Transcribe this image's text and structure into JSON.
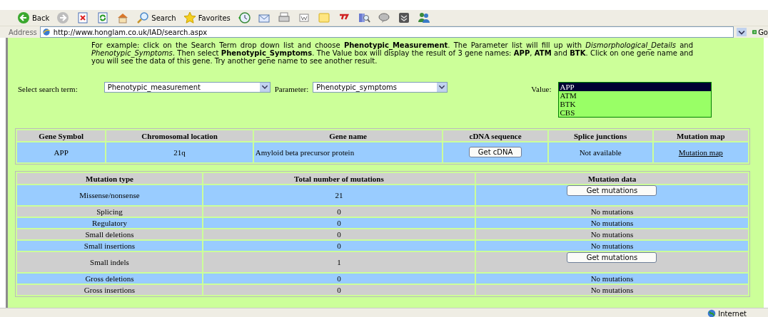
{
  "toolbar": {
    "buttons": [
      {
        "kind": "back",
        "label": "Back"
      },
      {
        "kind": "forward"
      },
      {
        "kind": "stop"
      },
      {
        "kind": "refresh"
      },
      {
        "kind": "home"
      },
      {
        "kind": "search",
        "label": "Search"
      },
      {
        "kind": "favorites",
        "label": "Favorites"
      },
      {
        "kind": "history"
      },
      {
        "kind": "mail"
      },
      {
        "kind": "print"
      },
      {
        "kind": "edit"
      },
      {
        "kind": "note"
      },
      {
        "kind": "yahoo"
      },
      {
        "kind": "research"
      },
      {
        "kind": "messenger"
      },
      {
        "kind": "discuss"
      },
      {
        "kind": "people"
      }
    ]
  },
  "address_bar": {
    "label": "Address",
    "url": "http://www.honglam.co.uk/IAD/search.aspx",
    "go": "Go"
  },
  "intro": "For example: click on the Search Term drop down list and choose **Phenotypic_Measurement**. The Parameter list will fill up with *Dismorphological_Details* and *Phenotypic_Symptoms*. Then select **Phenotypic_Symptoms**. The Value box will display the result of 3 gene names: **APP**, **ATM** and **BTK**. Click on one gene name and you will see the data of this gene. Try another gene name to see another result.",
  "search": {
    "term_label": "Select search term:",
    "term": "Phenotypic_measurement",
    "parameter_label": "Parameter:",
    "parameter": "Phenotypic_symptoms",
    "value_label": "Value:",
    "values": [
      {
        "label": "APP",
        "selected": true
      },
      {
        "label": "ATM",
        "selected": false
      },
      {
        "label": "BTK",
        "selected": false
      },
      {
        "label": "CBS",
        "selected": false
      }
    ]
  },
  "gene_table": {
    "columns": [
      "Gene Symbol",
      "Chromosomal location",
      "Gene name",
      "cDNA sequence",
      "Splice junctions",
      "Mutation map"
    ],
    "row": {
      "symbol": "APP",
      "location": "21q",
      "name": "Amyloid beta precursor protein",
      "cdna_button": "Get cDNA",
      "splice": "Not available",
      "map_link": "Mutation map"
    }
  },
  "mutation_table": {
    "columns": [
      "Mutation type",
      "Total number of mutations",
      "Mutation data"
    ],
    "rows": [
      {
        "type": "Missense/nonsense",
        "total": "21",
        "data": {
          "kind": "button",
          "text": "Get mutations"
        }
      },
      {
        "type": "Splicing",
        "total": "0",
        "data": {
          "kind": "text",
          "text": "No mutations"
        }
      },
      {
        "type": "Regulatory",
        "total": "0",
        "data": {
          "kind": "text",
          "text": "No mutations"
        }
      },
      {
        "type": "Small deletions",
        "total": "0",
        "data": {
          "kind": "text",
          "text": "No mutations"
        }
      },
      {
        "type": "Small insertions",
        "total": "0",
        "data": {
          "kind": "text",
          "text": "No mutations"
        }
      },
      {
        "type": "Small indels",
        "total": "1",
        "data": {
          "kind": "button",
          "text": "Get mutations"
        }
      },
      {
        "type": "Gross deletions",
        "total": "0",
        "data": {
          "kind": "text",
          "text": "No mutations"
        }
      },
      {
        "type": "Gross insertions",
        "total": "0",
        "data": {
          "kind": "text",
          "text": "No mutations"
        }
      }
    ]
  },
  "status_bar": {
    "zone": "Internet"
  }
}
